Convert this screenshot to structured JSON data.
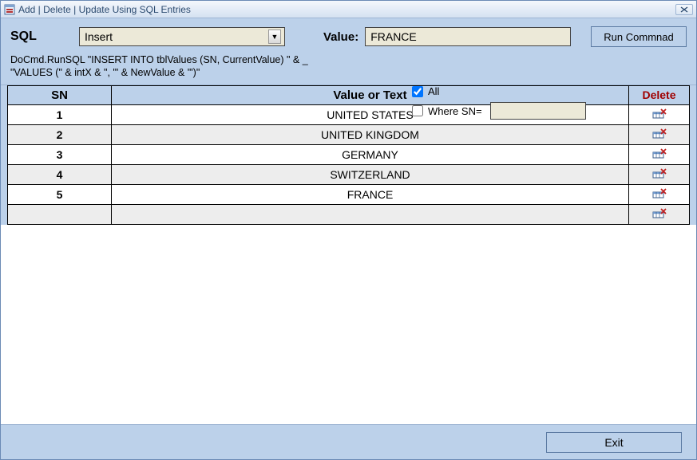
{
  "titlebar": {
    "title": "Add | Delete | Update Using SQL Entries"
  },
  "form": {
    "sql_label": "SQL",
    "sql_value": "Insert",
    "value_label": "Value:",
    "value_input": "FRANCE",
    "run_button": "Run Commnad",
    "code_line1": "DoCmd.RunSQL \"INSERT INTO tblValues (SN, CurrentValue) \" & _",
    "code_line2": "\"VALUES (\" & intX & \", '\" & NewValue & \"')\"",
    "opt_all": "All",
    "opt_all_checked": true,
    "opt_where": "Where SN=",
    "opt_where_checked": false,
    "sn_value": ""
  },
  "table": {
    "headers": {
      "sn": "SN",
      "value": "Value or Text",
      "delete": "Delete"
    },
    "rows": [
      {
        "sn": "1",
        "value": "UNITED STATES"
      },
      {
        "sn": "2",
        "value": "UNITED KINGDOM"
      },
      {
        "sn": "3",
        "value": "GERMANY"
      },
      {
        "sn": "4",
        "value": "SWITZERLAND"
      },
      {
        "sn": "5",
        "value": "FRANCE"
      },
      {
        "sn": "",
        "value": ""
      }
    ]
  },
  "footer": {
    "exit": "Exit"
  }
}
